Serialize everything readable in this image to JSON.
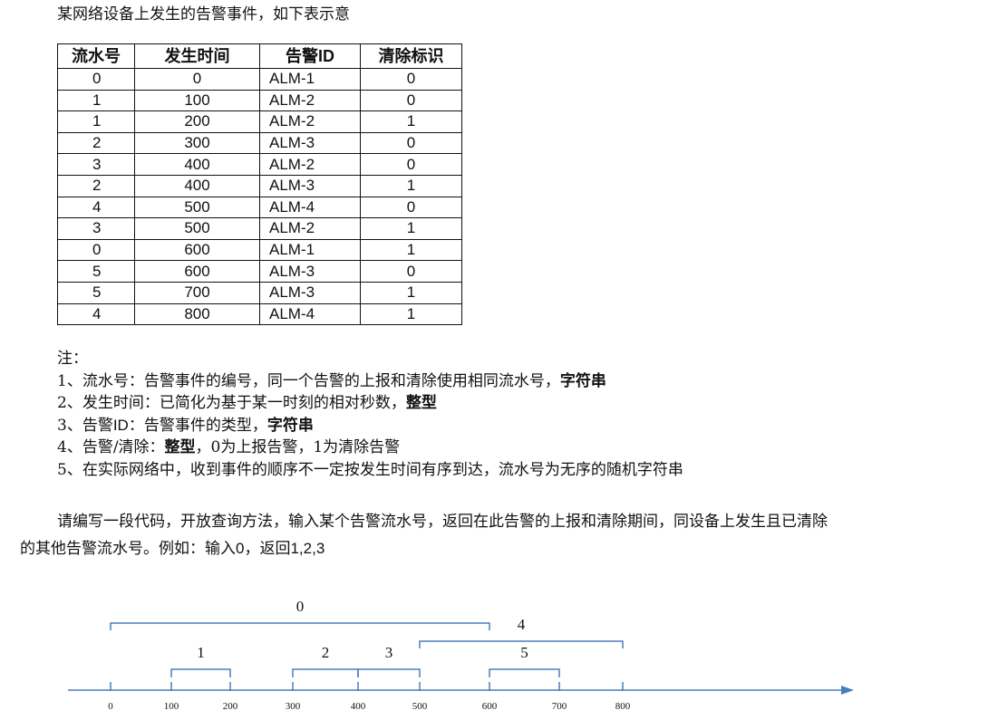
{
  "intro": "某网络设备上发生的告警事件，如下表示意",
  "table": {
    "headers": [
      "流水号",
      "发生时间",
      "告警ID",
      "清除标识"
    ],
    "rows": [
      [
        "0",
        "0",
        "ALM-1",
        "0"
      ],
      [
        "1",
        "100",
        "ALM-2",
        "0"
      ],
      [
        "1",
        "200",
        "ALM-2",
        "1"
      ],
      [
        "2",
        "300",
        "ALM-3",
        "0"
      ],
      [
        "3",
        "400",
        "ALM-2",
        "0"
      ],
      [
        "2",
        "400",
        "ALM-3",
        "1"
      ],
      [
        "4",
        "500",
        "ALM-4",
        "0"
      ],
      [
        "3",
        "500",
        "ALM-2",
        "1"
      ],
      [
        "0",
        "600",
        "ALM-1",
        "1"
      ],
      [
        "5",
        "600",
        "ALM-3",
        "0"
      ],
      [
        "5",
        "700",
        "ALM-3",
        "1"
      ],
      [
        "4",
        "800",
        "ALM-4",
        "1"
      ]
    ]
  },
  "notes": {
    "title": "注：",
    "n1_a": "1、流水号：告警事件的编号，同一个告警的上报和清除使用相同流水号，",
    "n1_b": "字符串",
    "n2_a": "2、发生时间：已简化为基于某一时刻的相对秒数，",
    "n2_b": "整型",
    "n3_a": "3、告警",
    "n3_s": "ID",
    "n3_c": "：告警事件的类型，",
    "n3_b": "字符串",
    "n4_a": "4、告警/清除：",
    "n4_b": "整型",
    "n4_c": "，",
    "n4_d": "0为上报告警，1为清除告警",
    "n5": "5、在实际网络中，收到事件的顺序不一定按发生时间有序到达，流水号为无序的随机字符串"
  },
  "task": {
    "line1": "请编写一段代码，开放查询方法，输入某个告警流水号，返回在此告警的上报和清除期间，同设备上发生且已清除",
    "line2_a": "的其他告警流水号。例如：输入",
    "line2_b": "0",
    "line2_c": "，返回",
    "line2_d": "1,2,3"
  },
  "timeline": {
    "ticks": [
      0,
      100,
      200,
      300,
      400,
      500,
      600,
      700,
      800
    ],
    "tick_labels": [
      "0",
      "100",
      "200",
      "300",
      "400",
      "500",
      "600",
      "700",
      "800"
    ],
    "intervals": [
      {
        "id": "0",
        "start": 0,
        "end": 600,
        "row": "top"
      },
      {
        "id": "4",
        "start": 500,
        "end": 800,
        "row": "upper"
      },
      {
        "id": "1",
        "start": 100,
        "end": 200,
        "row": "lower"
      },
      {
        "id": "2",
        "start": 300,
        "end": 400,
        "row": "lower"
      },
      {
        "id": "3",
        "start": 400,
        "end": 500,
        "row": "lower"
      },
      {
        "id": "5",
        "start": 600,
        "end": 700,
        "row": "lower"
      }
    ],
    "axis_color": "#4a7ebb",
    "bracket_color": "#4a7ebb"
  }
}
